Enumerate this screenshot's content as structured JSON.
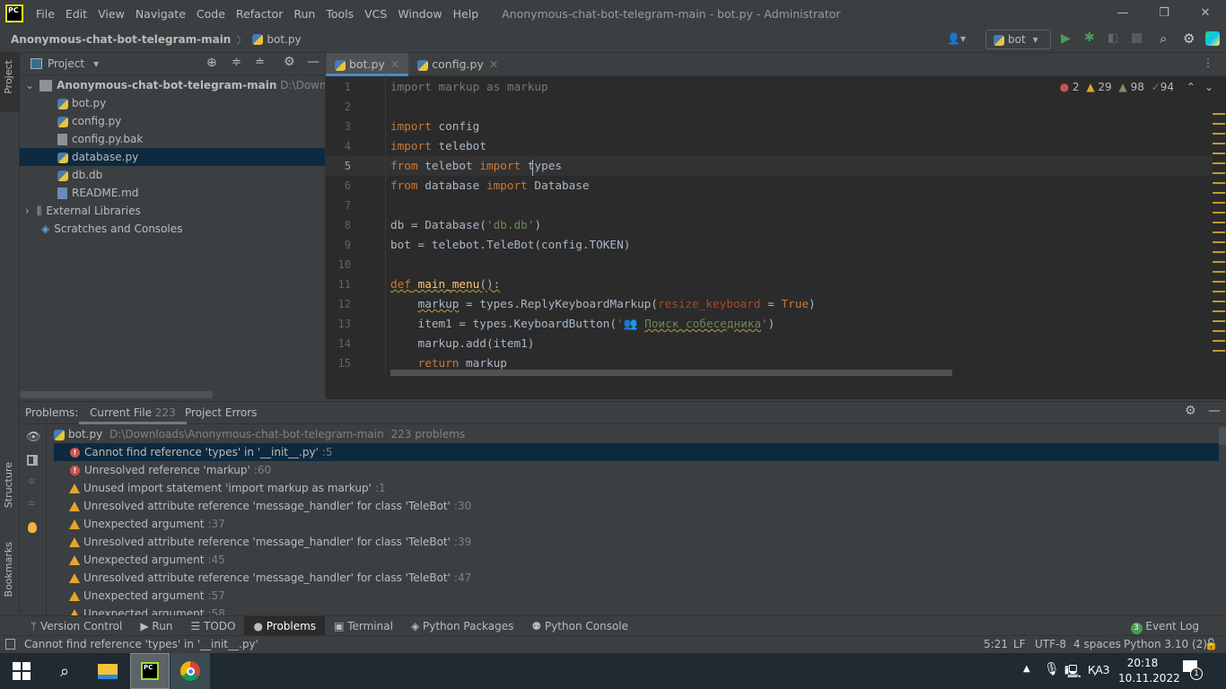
{
  "titlebar": {
    "menu": [
      "File",
      "Edit",
      "View",
      "Navigate",
      "Code",
      "Refactor",
      "Run",
      "Tools",
      "VCS",
      "Window",
      "Help"
    ],
    "title": "Anonymous-chat-bot-telegram-main - bot.py - Administrator"
  },
  "navbar": {
    "project": "Anonymous-chat-bot-telegram-main",
    "file": "bot.py",
    "run_config": "bot"
  },
  "project": {
    "header": "Project",
    "strip_label": "Project",
    "root": "Anonymous-chat-bot-telegram-main",
    "root_path": "D:\\Downloads\\A",
    "files": [
      {
        "name": "bot.py",
        "type": "py"
      },
      {
        "name": "config.py",
        "type": "py"
      },
      {
        "name": "config.py.bak",
        "type": "file"
      },
      {
        "name": "database.py",
        "type": "py",
        "selected": true
      },
      {
        "name": "db.db",
        "type": "py"
      },
      {
        "name": "README.md",
        "type": "md"
      }
    ],
    "external": "External Libraries",
    "scratches": "Scratches and Consoles"
  },
  "editor": {
    "tabs": [
      {
        "name": "bot.py",
        "active": true
      },
      {
        "name": "config.py"
      }
    ],
    "inspections": {
      "errors": "2",
      "warnings": "29",
      "weak_warnings": "98",
      "typos": "94"
    },
    "current_line": 5,
    "lines": [
      [
        [
          "import markup as markup",
          "dim"
        ]
      ],
      [],
      [
        [
          "import",
          "kw"
        ],
        [
          " config",
          ""
        ]
      ],
      [
        [
          "import",
          "kw"
        ],
        [
          " telebot",
          ""
        ]
      ],
      [
        [
          "from",
          "kw"
        ],
        [
          " telebot ",
          ""
        ],
        [
          "import",
          "kw"
        ],
        [
          " types",
          ""
        ]
      ],
      [
        [
          "from",
          "kw"
        ],
        [
          " database ",
          ""
        ],
        [
          "import",
          "kw"
        ],
        [
          " Database",
          ""
        ]
      ],
      [],
      [
        [
          "db = Database(",
          ""
        ],
        [
          "'db.db'",
          "str"
        ],
        [
          ")",
          ""
        ]
      ],
      [
        [
          "bot = telebot.TeleBot(config.TOKEN)",
          ""
        ]
      ],
      [],
      [
        [
          "def",
          "kw squig"
        ],
        [
          " ",
          "squig"
        ],
        [
          "main_menu",
          "fn squig"
        ],
        [
          "():",
          "squig"
        ]
      ],
      [
        [
          "    ",
          ""
        ],
        [
          "markup",
          "squig"
        ],
        [
          " = types.ReplyKeyboardMarkup(",
          ""
        ],
        [
          "resize_keyboard",
          "prm"
        ],
        [
          " = ",
          ""
        ],
        [
          "True",
          "kw"
        ],
        [
          ")",
          ""
        ]
      ],
      [
        [
          "    item1 = types.KeyboardButton(",
          ""
        ],
        [
          "'👥 ",
          "str"
        ],
        [
          "Поиск собеседника",
          "str squig"
        ],
        [
          "'",
          "str"
        ],
        [
          ")",
          ""
        ]
      ],
      [
        [
          "    markup.add(item1)",
          ""
        ]
      ],
      [
        [
          "    ",
          ""
        ],
        [
          "return",
          "kw"
        ],
        [
          " markup",
          ""
        ]
      ]
    ]
  },
  "problems": {
    "label": "Problems:",
    "tabs": [
      {
        "name": "Current File",
        "count": "223"
      },
      {
        "name": "Project Errors"
      }
    ],
    "file": "bot.py",
    "file_path": "D:\\Downloads\\Anonymous-chat-bot-telegram-main",
    "file_count": "223 problems",
    "items": [
      {
        "level": "error",
        "text": "Cannot find reference 'types' in '__init__.py'",
        "line": ":5",
        "selected": true
      },
      {
        "level": "error",
        "text": "Unresolved reference 'markup'",
        "line": ":60"
      },
      {
        "level": "warning",
        "text": "Unused import statement 'import markup as markup'",
        "line": ":1"
      },
      {
        "level": "warning",
        "text": "Unresolved attribute reference 'message_handler' for class 'TeleBot'",
        "line": ":30"
      },
      {
        "level": "warning",
        "text": "Unexpected argument",
        "line": ":37"
      },
      {
        "level": "warning",
        "text": "Unresolved attribute reference 'message_handler' for class 'TeleBot'",
        "line": ":39"
      },
      {
        "level": "warning",
        "text": "Unexpected argument",
        "line": ":45"
      },
      {
        "level": "warning",
        "text": "Unresolved attribute reference 'message_handler' for class 'TeleBot'",
        "line": ":47"
      },
      {
        "level": "warning",
        "text": "Unexpected argument",
        "line": ":57"
      },
      {
        "level": "warning",
        "text": "Unexpected argument",
        "line": ":58"
      }
    ],
    "strip": [
      "Structure",
      "Bookmarks"
    ]
  },
  "toolwindows": {
    "items": [
      "Version Control",
      "Run",
      "TODO",
      "Problems",
      "Terminal",
      "Python Packages",
      "Python Console"
    ],
    "active": "Problems",
    "event_log": "Event Log",
    "event_count": "3"
  },
  "status": {
    "message": "Cannot find reference 'types' in '__init__.py'",
    "position": "5:21",
    "line_sep": "LF",
    "encoding": "UTF-8",
    "indent": "4 spaces",
    "interpreter": "Python 3.10 (2)"
  },
  "taskbar": {
    "lang": "ҚАЗ",
    "time": "20:18",
    "date": "10.11.2022",
    "notifications": "1"
  }
}
